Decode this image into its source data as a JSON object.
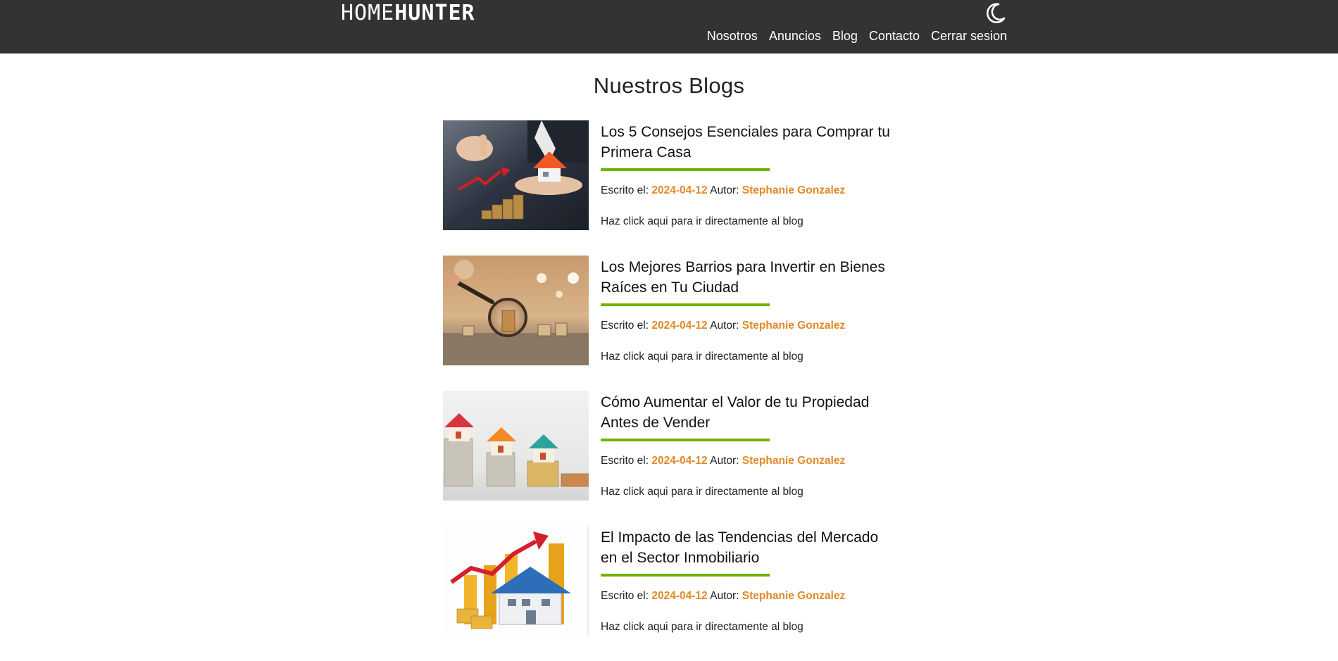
{
  "header": {
    "logo_light": "HOME",
    "logo_bold": "HUNTER",
    "theme_toggle_icon": "moon-icon",
    "nav": [
      {
        "label": "Nosotros"
      },
      {
        "label": "Anuncios"
      },
      {
        "label": "Blog"
      },
      {
        "label": "Contacto"
      },
      {
        "label": "Cerrar sesion"
      }
    ],
    "colors": {
      "background": "#333333",
      "text": "#ffffff"
    }
  },
  "page": {
    "title": "Nuestros Blogs"
  },
  "labels": {
    "written_on": "Escrito el:",
    "author": "Autor:",
    "go_to_blog": "Haz click aqui para ir directamente al blog"
  },
  "posts": [
    {
      "title": "Los 5 Consejos Esenciales para Comprar tu Primera Casa",
      "date": "2024-04-12",
      "author": "Stephanie Gonzalez"
    },
    {
      "title": "Los Mejores Barrios para Invertir en Bienes Raíces en Tu Ciudad",
      "date": "2024-04-12",
      "author": "Stephanie Gonzalez"
    },
    {
      "title": "Cómo Aumentar el Valor de tu Propiedad Antes de Vender",
      "date": "2024-04-12",
      "author": "Stephanie Gonzalez"
    },
    {
      "title": "El Impacto de las Tendencias del Mercado en el Sector Inmobiliario",
      "date": "2024-04-12",
      "author": "Stephanie Gonzalez"
    }
  ],
  "colors": {
    "accent_underline": "#71b100",
    "accent_meta": "#e08a29"
  }
}
